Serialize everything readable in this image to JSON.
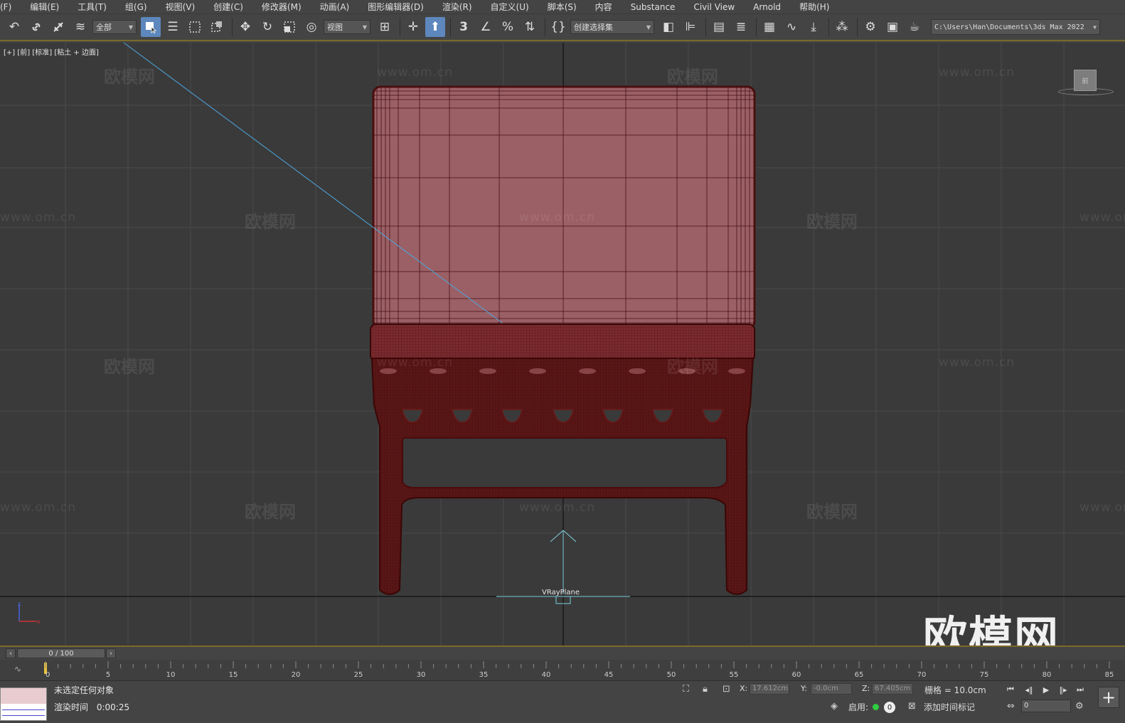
{
  "menu": [
    {
      "id": "file",
      "label": "(F)"
    },
    {
      "id": "edit",
      "label": "编辑(E)"
    },
    {
      "id": "tools",
      "label": "工具(T)"
    },
    {
      "id": "group",
      "label": "组(G)"
    },
    {
      "id": "views",
      "label": "视图(V)"
    },
    {
      "id": "create",
      "label": "创建(C)"
    },
    {
      "id": "modifiers",
      "label": "修改器(M)"
    },
    {
      "id": "animation",
      "label": "动画(A)"
    },
    {
      "id": "graph-editors",
      "label": "图形编辑器(D)"
    },
    {
      "id": "rendering",
      "label": "渲染(R)"
    },
    {
      "id": "customize",
      "label": "自定义(U)"
    },
    {
      "id": "scripting",
      "label": "脚本(S)"
    },
    {
      "id": "content",
      "label": "内容"
    },
    {
      "id": "substance",
      "label": "Substance"
    },
    {
      "id": "civil-view",
      "label": "Civil View"
    },
    {
      "id": "arnold",
      "label": "Arnold"
    },
    {
      "id": "help",
      "label": "帮助(H)"
    }
  ],
  "toolbar": {
    "selection_filter": "全部",
    "ref_coord": "视图",
    "named_selection": "创建选择集",
    "project_path": "C:\\Users\\Han\\Documents\\3ds Max 2022",
    "icons": {
      "undo": "undo-icon",
      "link": "link-icon",
      "unlink": "unlink-icon",
      "bind_space_warp": "bind-space-warp-icon",
      "select": "select-object-icon",
      "select_by_name": "select-by-name-icon",
      "rect_region": "rectangle-region-icon",
      "window_crossing": "window-crossing-icon",
      "move": "move-icon",
      "rotate": "rotate-icon",
      "scale": "scale-icon",
      "place": "place-icon",
      "pivot": "pivot-icon",
      "manipulate": "manipulate-icon",
      "snap_3d": "snap-3d-icon",
      "angle_snap": "angle-snap-icon",
      "percent_snap": "percent-snap-icon",
      "spinner_snap": "spinner-snap-icon",
      "edit_named_sel": "edit-named-selection-icon",
      "mirror": "mirror-icon",
      "align": "align-icon",
      "scene_explorer": "scene-explorer-icon",
      "layer_explorer": "layer-explorer-icon",
      "ribbon": "ribbon-icon",
      "curve_editor": "curve-editor-icon",
      "schematic": "schematic-view-icon",
      "material_editor": "material-editor-icon",
      "render_setup": "render-setup-icon",
      "rendered_frame": "rendered-frame-window-icon",
      "render": "render-production-icon"
    }
  },
  "viewport": {
    "label": "[+] [前] [标准] [粘土 + 边面]",
    "object_label": "VRayPlane",
    "viewcube_label": "前",
    "watermark_cn": "欧模网",
    "watermark_url": "www.om.cn",
    "logo": "欧模网",
    "colors": {
      "background": "#3a3a3a",
      "grid": "#4b4b4b",
      "mesh_fill": "#9b6066",
      "mesh_dark": "#4a0f0f",
      "wire": "#3a0808",
      "light_line": "#4ca8e0"
    }
  },
  "timeslider": {
    "value": "0 / 100",
    "ticks": [
      "0",
      "5",
      "10",
      "15",
      "20",
      "25",
      "30",
      "35",
      "40",
      "45",
      "50",
      "55",
      "60",
      "65",
      "70",
      "75",
      "80",
      "85"
    ]
  },
  "status": {
    "message": "未选定任何对象",
    "render_time_label": "渲染时间",
    "render_time": "0:00:25",
    "x_label": "X:",
    "x_value": "17.612cm",
    "y_label": "Y:",
    "y_value": "-0.0cm",
    "z_label": "Z:",
    "z_value": "67.405cm",
    "grid": "栅格 = 10.0cm",
    "enable": "启用:",
    "key_count": "0",
    "add_time_tag": "添加时间标记",
    "frame_value": "0"
  }
}
